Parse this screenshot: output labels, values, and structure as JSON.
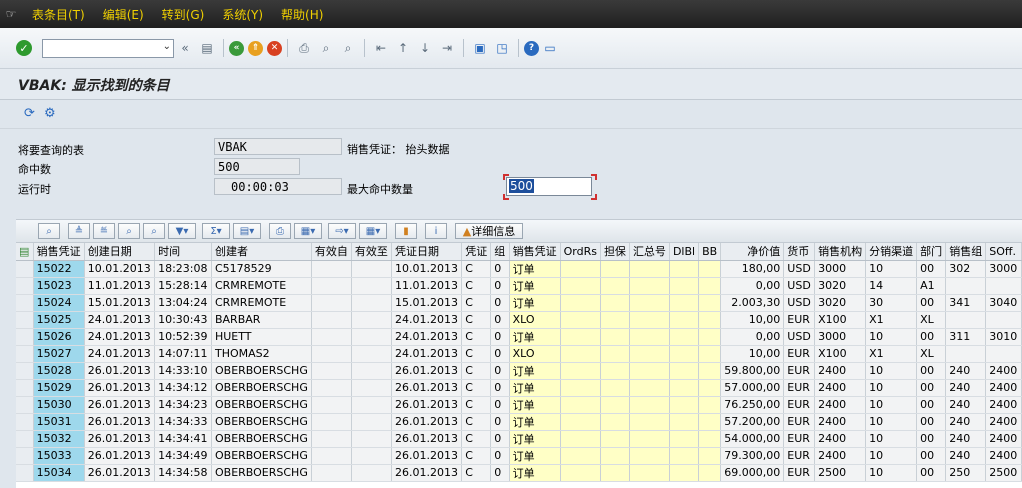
{
  "menu": {
    "items": [
      "表条目(T)",
      "编辑(E)",
      "转到(G)",
      "系统(Y)",
      "帮助(H)"
    ]
  },
  "title": "VBAK: 显示找到的条目",
  "params": {
    "table_label": "将要查询的表",
    "table_value": "VBAK",
    "table_desc": "销售凭证： 抬头数据",
    "hits_label": "命中数",
    "hits_value": "500",
    "runtime_label": "运行时",
    "runtime_value": "00:00:03",
    "maxhits_label": "最大命中数量",
    "maxhits_value": "500"
  },
  "grid_toolbar": {
    "detail_label": "详细信息"
  },
  "table": {
    "columns": [
      "销售凭证",
      "创建日期",
      "时间",
      "创建者",
      "有效自",
      "有效至",
      "凭证日期",
      "凭证",
      "组",
      "销售凭证",
      "OrdRs",
      "担保",
      "汇总号",
      "DlBl",
      "BB",
      "净价值",
      "货币",
      "销售机构",
      "分销渠道",
      "部门",
      "销售组",
      "SOff."
    ],
    "rows": [
      [
        "15022",
        "10.01.2013",
        "18:23:08",
        "C5178529",
        "",
        "",
        "10.01.2013",
        "C",
        "0",
        "订单",
        "",
        "",
        "",
        "",
        "",
        "180,00",
        "USD",
        "3000",
        "10",
        "00",
        "302",
        "3000"
      ],
      [
        "15023",
        "11.01.2013",
        "15:28:14",
        "CRMREMOTE",
        "",
        "",
        "11.01.2013",
        "C",
        "0",
        "订单",
        "",
        "",
        "",
        "",
        "",
        "0,00",
        "USD",
        "3020",
        "14",
        "A1",
        "",
        ""
      ],
      [
        "15024",
        "15.01.2013",
        "13:04:24",
        "CRMREMOTE",
        "",
        "",
        "15.01.2013",
        "C",
        "0",
        "订单",
        "",
        "",
        "",
        "",
        "",
        "2.003,30",
        "USD",
        "3020",
        "30",
        "00",
        "341",
        "3040"
      ],
      [
        "15025",
        "24.01.2013",
        "10:30:43",
        "BARBAR",
        "",
        "",
        "24.01.2013",
        "C",
        "0",
        "XLO",
        "",
        "",
        "",
        "",
        "",
        "10,00",
        "EUR",
        "X100",
        "X1",
        "XL",
        "",
        ""
      ],
      [
        "15026",
        "24.01.2013",
        "10:52:39",
        "HUETT",
        "",
        "",
        "24.01.2013",
        "C",
        "0",
        "订单",
        "",
        "",
        "",
        "",
        "",
        "0,00",
        "USD",
        "3000",
        "10",
        "00",
        "311",
        "3010"
      ],
      [
        "15027",
        "24.01.2013",
        "14:07:11",
        "THOMAS2",
        "",
        "",
        "24.01.2013",
        "C",
        "0",
        "XLO",
        "",
        "",
        "",
        "",
        "",
        "10,00",
        "EUR",
        "X100",
        "X1",
        "XL",
        "",
        ""
      ],
      [
        "15028",
        "26.01.2013",
        "14:33:10",
        "OBERBOERSCHG",
        "",
        "",
        "26.01.2013",
        "C",
        "0",
        "订单",
        "",
        "",
        "",
        "",
        "",
        "59.800,00",
        "EUR",
        "2400",
        "10",
        "00",
        "240",
        "2400"
      ],
      [
        "15029",
        "26.01.2013",
        "14:34:12",
        "OBERBOERSCHG",
        "",
        "",
        "26.01.2013",
        "C",
        "0",
        "订单",
        "",
        "",
        "",
        "",
        "",
        "57.000,00",
        "EUR",
        "2400",
        "10",
        "00",
        "240",
        "2400"
      ],
      [
        "15030",
        "26.01.2013",
        "14:34:23",
        "OBERBOERSCHG",
        "",
        "",
        "26.01.2013",
        "C",
        "0",
        "订单",
        "",
        "",
        "",
        "",
        "",
        "76.250,00",
        "EUR",
        "2400",
        "10",
        "00",
        "240",
        "2400"
      ],
      [
        "15031",
        "26.01.2013",
        "14:34:33",
        "OBERBOERSCHG",
        "",
        "",
        "26.01.2013",
        "C",
        "0",
        "订单",
        "",
        "",
        "",
        "",
        "",
        "57.200,00",
        "EUR",
        "2400",
        "10",
        "00",
        "240",
        "2400"
      ],
      [
        "15032",
        "26.01.2013",
        "14:34:41",
        "OBERBOERSCHG",
        "",
        "",
        "26.01.2013",
        "C",
        "0",
        "订单",
        "",
        "",
        "",
        "",
        "",
        "54.000,00",
        "EUR",
        "2400",
        "10",
        "00",
        "240",
        "2400"
      ],
      [
        "15033",
        "26.01.2013",
        "14:34:49",
        "OBERBOERSCHG",
        "",
        "",
        "26.01.2013",
        "C",
        "0",
        "订单",
        "",
        "",
        "",
        "",
        "",
        "79.300,00",
        "EUR",
        "2400",
        "10",
        "00",
        "240",
        "2400"
      ],
      [
        "15034",
        "26.01.2013",
        "14:34:58",
        "OBERBOERSCHG",
        "",
        "",
        "26.01.2013",
        "C",
        "0",
        "订单",
        "",
        "",
        "",
        "",
        "",
        "69.000,00",
        "EUR",
        "2500",
        "10",
        "00",
        "250",
        "2500"
      ]
    ]
  }
}
